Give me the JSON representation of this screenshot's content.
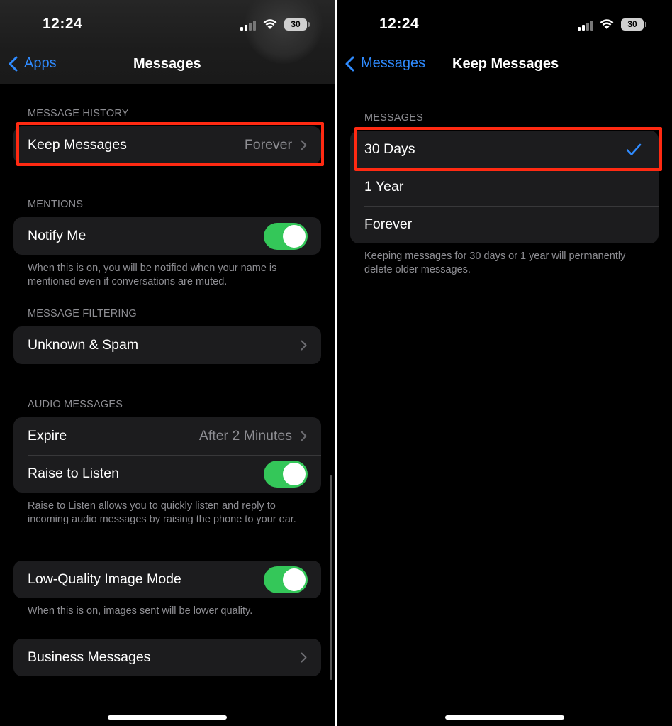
{
  "status": {
    "time": "12:24",
    "battery": "30"
  },
  "left": {
    "nav": {
      "back_label": "Apps",
      "title": "Messages"
    },
    "message_history": {
      "header": "MESSAGE HISTORY",
      "keep_messages": {
        "label": "Keep Messages",
        "value": "Forever"
      }
    },
    "mentions": {
      "header": "MENTIONS",
      "notify_me": {
        "label": "Notify Me",
        "on": true
      },
      "footer": "When this is on, you will be notified when your name is mentioned even if conversations are muted."
    },
    "message_filtering": {
      "header": "MESSAGE FILTERING",
      "unknown_spam": {
        "label": "Unknown & Spam"
      }
    },
    "audio_messages": {
      "header": "AUDIO MESSAGES",
      "expire": {
        "label": "Expire",
        "value": "After 2 Minutes"
      },
      "raise_to_listen": {
        "label": "Raise to Listen",
        "on": true
      },
      "footer": "Raise to Listen allows you to quickly listen and reply to incoming audio messages by raising the phone to your ear."
    },
    "low_quality": {
      "label": "Low-Quality Image Mode",
      "on": true,
      "footer": "When this is on, images sent will be lower quality."
    },
    "business_messages": {
      "label": "Business Messages"
    }
  },
  "right": {
    "nav": {
      "back_label": "Messages",
      "title": "Keep Messages"
    },
    "header": "MESSAGES",
    "options": [
      {
        "label": "30 Days",
        "selected": true
      },
      {
        "label": "1 Year",
        "selected": false
      },
      {
        "label": "Forever",
        "selected": false
      }
    ],
    "footer": "Keeping messages for 30 days or 1 year will permanently delete older messages."
  },
  "colors": {
    "accent": "#2f8bff",
    "toggle_on": "#34c759",
    "highlight": "#ff2a12"
  },
  "icons": [
    "chevron-left-icon",
    "chevron-right-icon",
    "checkmark-icon",
    "wifi-icon",
    "cellular-signal-icon",
    "battery-icon"
  ]
}
